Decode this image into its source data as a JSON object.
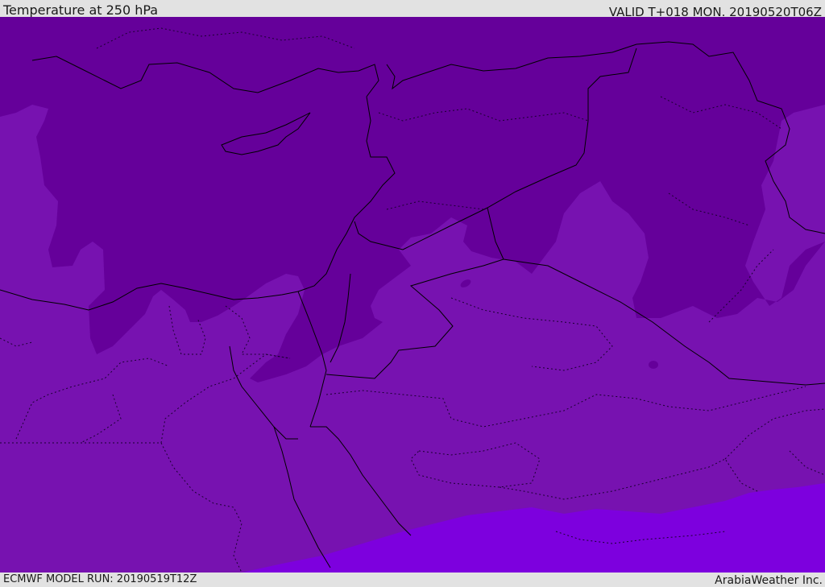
{
  "header": {
    "title": "Temperature at 250 hPa",
    "valid": "VALID T+018 MON. 20190520T06Z"
  },
  "footer": {
    "model_run": "ECMWF MODEL RUN: 20190519T12Z",
    "brand": "ArabiaWeather Inc."
  },
  "map": {
    "layer": "temperature-at-250-hpa",
    "colors": {
      "coldest_band": "#65009a",
      "middle_band": "#7712b0",
      "warmest_band": "#7d00de",
      "coastline": "#000000",
      "borders": "#000000"
    }
  }
}
